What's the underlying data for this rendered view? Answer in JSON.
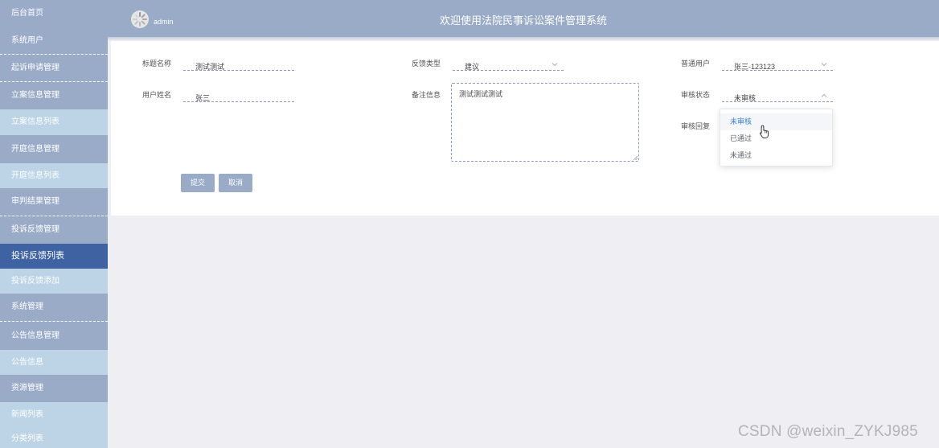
{
  "sidebar": {
    "items": [
      {
        "label": "后台首页"
      },
      {
        "label": "系统用户"
      },
      {
        "label": "起诉申请管理"
      },
      {
        "label": "立案信息管理"
      },
      {
        "label": "立案信息列表"
      },
      {
        "label": "开庭信息管理"
      },
      {
        "label": "开庭信息列表"
      },
      {
        "label": "审判结果管理"
      },
      {
        "label": "投诉反馈管理"
      },
      {
        "label": "投诉反馈列表"
      },
      {
        "label": "投诉反馈添加"
      },
      {
        "label": "系统管理"
      },
      {
        "label": "公告信息管理"
      },
      {
        "label": "公告信息"
      },
      {
        "label": "资源管理"
      },
      {
        "label": "新闻列表"
      },
      {
        "label": "分类列表"
      }
    ]
  },
  "header": {
    "username": "admin",
    "title": "欢迎使用法院民事诉讼案件管理系统"
  },
  "form": {
    "title_label": "标题名称",
    "title_value": "测试测试",
    "feedback_type_label": "反馈类型",
    "feedback_type_value": "建议",
    "user_label": "普通用户",
    "user_value": "张三-123123",
    "username_label": "用户姓名",
    "username_value": "张三",
    "remark_label": "备注信息",
    "remark_value": "测试测试测试",
    "review_status_label": "审核状态",
    "review_status_value": "未审核",
    "review_reply_label": "审核回复"
  },
  "buttons": {
    "submit": "提交",
    "cancel": "取消"
  },
  "dropdown": {
    "options": [
      "未审核",
      "已通过",
      "未通过"
    ],
    "selected_index": 0
  },
  "watermark": "CSDN @weixin_ZYKJ985",
  "colors": {
    "sidebar_bg": "#9aabc8",
    "sidebar_sub_bg": "#bcd4e6",
    "sidebar_active_bg": "#3f63a2",
    "accent_blue": "#3d7fd0"
  }
}
